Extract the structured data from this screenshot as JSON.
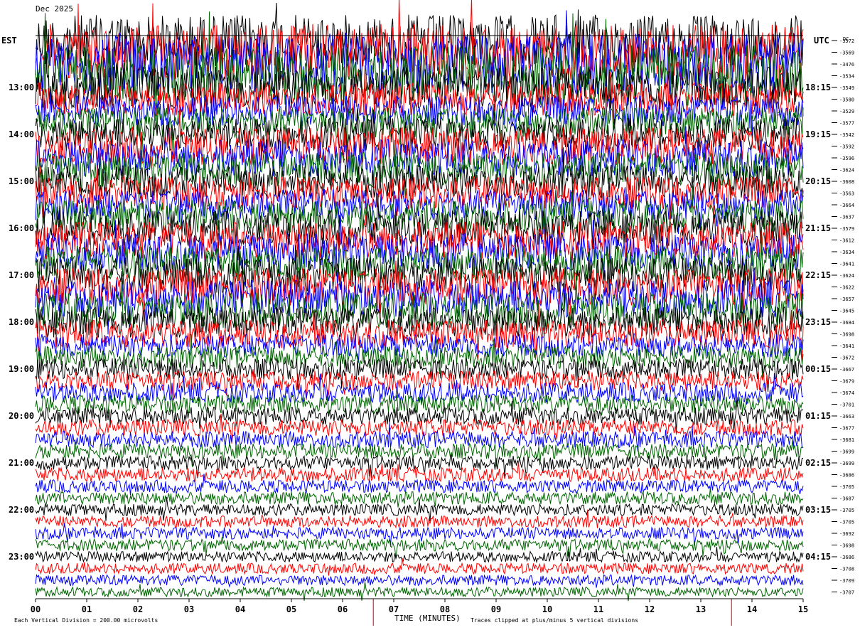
{
  "header": {
    "date_line": "Dec 2025",
    "left_zone": "EST",
    "right_zone": "UTC",
    "dc_heading": "DC"
  },
  "footer": {
    "scale_note": "Each Vertical Division =  200.00 microvolts",
    "x_axis_label": "TIME (MINUTES)",
    "clip_note": "Traces clipped at plus/minus 5 vertical divisions"
  },
  "colors": {
    "trace_cycle": [
      "#000000",
      "#ff0000",
      "#0000ff",
      "#006400"
    ],
    "marker_line": "#cc0000",
    "background": "#ffffff"
  },
  "chart_data": {
    "type": "line",
    "subtype": "helicorder",
    "x_ticks": [
      "00",
      "01",
      "02",
      "03",
      "04",
      "05",
      "06",
      "07",
      "08",
      "09",
      "10",
      "11",
      "12",
      "13",
      "14",
      "15"
    ],
    "xlim": [
      0,
      15
    ],
    "left_hour_labels": [
      "13:00",
      "14:00",
      "15:00",
      "16:00",
      "17:00",
      "18:00",
      "19:00",
      "20:00",
      "21:00",
      "22:00",
      "23:00"
    ],
    "right_hour_labels": [
      "18:15",
      "19:15",
      "20:15",
      "21:15",
      "22:15",
      "23:15",
      "00:15",
      "01:15",
      "02:15",
      "03:15",
      "04:15"
    ],
    "dc_offsets": [
      "-3572",
      "-3569",
      "-3476",
      "-3534",
      "-3549",
      "-3580",
      "-3529",
      "-3577",
      "-3542",
      "-3592",
      "-3596",
      "-3624",
      "-3608",
      "-3563",
      "-3664",
      "-3637",
      "-3579",
      "-3612",
      "-3634",
      "-3641",
      "-3624",
      "-3622",
      "-3657",
      "-3645",
      "-3684",
      "-3698",
      "-3641",
      "-3672",
      "-3667",
      "-3679",
      "-3674",
      "-3701",
      "-3663",
      "-3677",
      "-3681",
      "-3699",
      "-3699",
      "-3686",
      "-3705",
      "-3687",
      "-3705",
      "-3705",
      "-3692",
      "-3698",
      "-3686",
      "-3708",
      "-3709",
      "-3707"
    ],
    "trace_amplitude": [
      2.2,
      2.4,
      2.6,
      2.6,
      1.8,
      1.4,
      1.3,
      1.3,
      1.4,
      1.6,
      1.6,
      1.5,
      1.4,
      1.4,
      1.3,
      1.4,
      1.5,
      1.6,
      1.6,
      1.5,
      1.5,
      1.6,
      1.6,
      1.5,
      1.3,
      1.2,
      1.0,
      0.95,
      0.9,
      0.85,
      0.85,
      0.8,
      0.75,
      0.7,
      0.7,
      0.65,
      0.6,
      0.6,
      0.55,
      0.55,
      0.5,
      0.5,
      0.5,
      0.5,
      0.45,
      0.45,
      0.45,
      0.4
    ],
    "marker_minutes": [
      6.6,
      13.6
    ]
  }
}
